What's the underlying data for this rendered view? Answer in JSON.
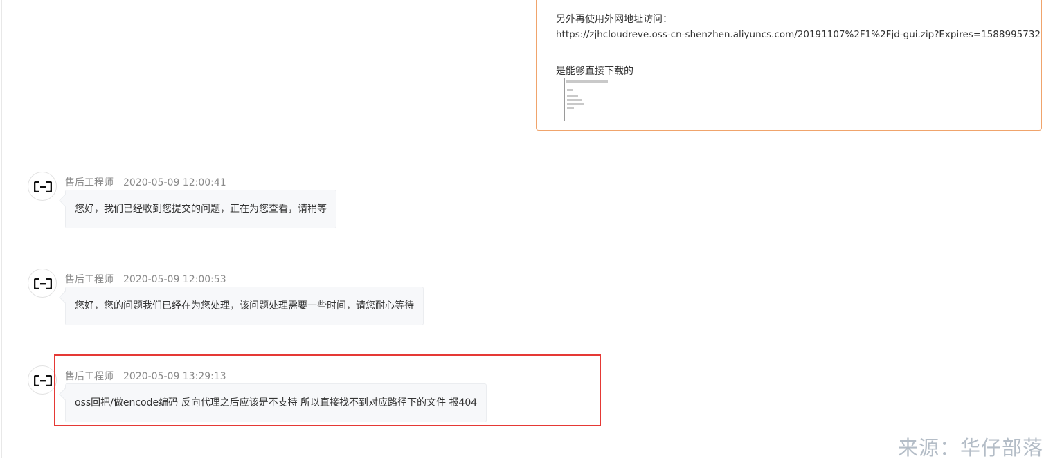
{
  "user_message": {
    "lines": [
      "另外再使用外网地址访问：",
      "https://zjhcloudreve.oss-cn-shenzhen.aliyuncs.com/20191107%2F1%2Fjd-gui.zip?Expires=1588995732",
      "是能够直接下载的"
    ]
  },
  "messages": [
    {
      "sender": "售后工程师",
      "time": "2020-05-09 12:00:41",
      "text": "您好，我们已经收到您提交的问题，正在为您查看，请稍等"
    },
    {
      "sender": "售后工程师",
      "time": "2020-05-09 12:00:53",
      "text": "您好，您的问题我们已经在为您处理，该问题处理需要一些时间，请您耐心等待"
    },
    {
      "sender": "售后工程师",
      "time": "2020-05-09 13:29:13",
      "text": "oss回把/做encode编码   反向代理之后应该是不支持  所以直接找不到对应路径下的文件 报404"
    }
  ],
  "watermark": "来源：华仔部落",
  "colors": {
    "user_bubble_border": "#f0a46c",
    "highlight": "#e53935",
    "engineer_bubble_bg": "#f7f8fa"
  },
  "icons": {
    "avatar": "aliyun-logo-icon"
  }
}
